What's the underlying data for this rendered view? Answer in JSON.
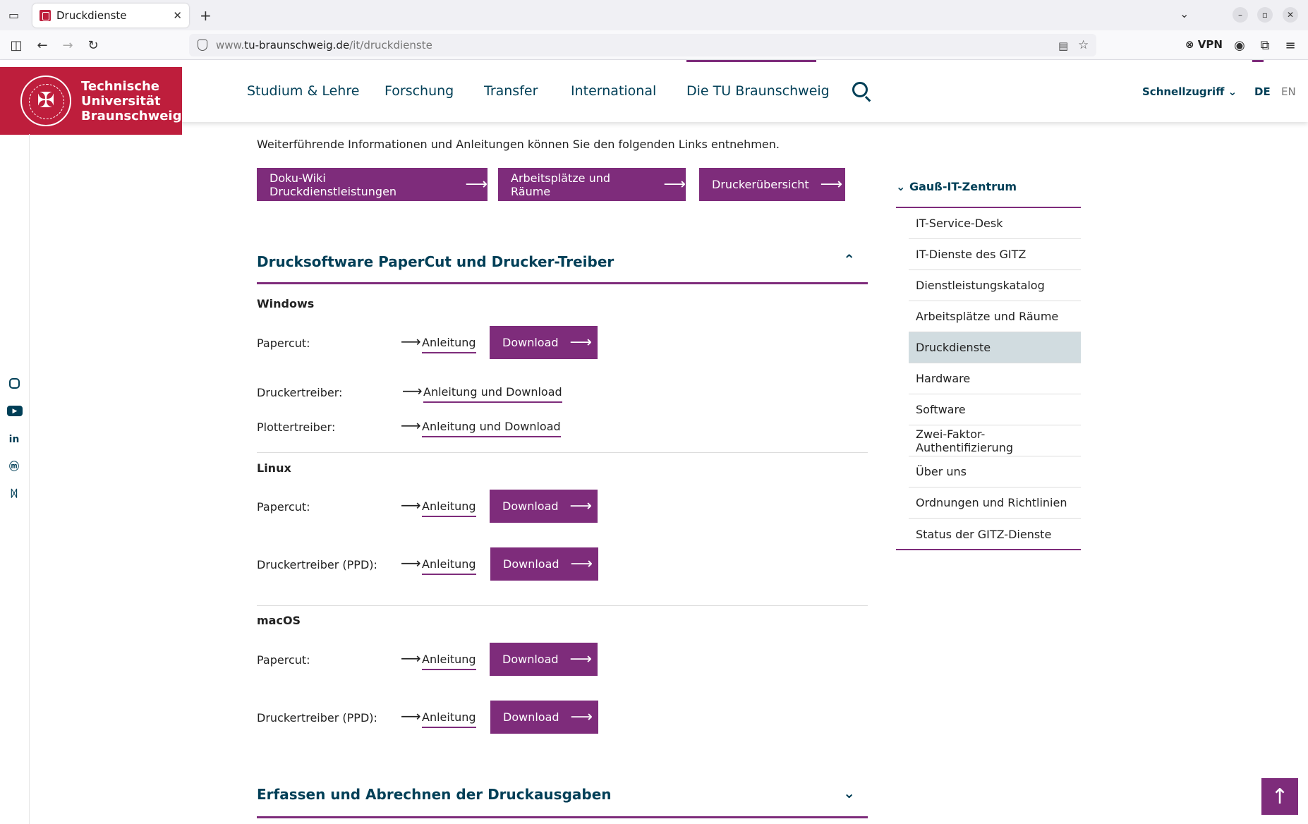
{
  "browser": {
    "tab_title": "Druckdienste",
    "url_prefix": "www.",
    "url_domain": "tu-braunschweig.de",
    "url_path": "/it/druckdienste",
    "vpn_label": "VPN"
  },
  "header": {
    "logo_lines": [
      "Technische",
      "Universität",
      "Braunschweig"
    ],
    "nav": [
      "Studium & Lehre",
      "Forschung",
      "Transfer",
      "International",
      "Die TU Braunschweig"
    ],
    "quick_access": "Schnellzugriff",
    "lang_de": "DE",
    "lang_en": "EN"
  },
  "content": {
    "intro": "Weiterführende Informationen und Anleitungen können Sie den folgenden Links entnehmen.",
    "top_buttons": [
      "Doku-Wiki Druckdienstleistungen",
      "Arbeitsplätze und Räume",
      "Druckerübersicht"
    ],
    "accordion1_title": "Drucksoftware PaperCut und Drucker-Treiber",
    "windows": {
      "label": "Windows",
      "papercut_label": "Papercut:",
      "papercut_link": "Anleitung",
      "papercut_download": "Download",
      "druckertreiber_label": "Druckertreiber:",
      "druckertreiber_link": "Anleitung und Download",
      "plottertreiber_label": "Plottertreiber:",
      "plottertreiber_link": "Anleitung und Download"
    },
    "linux": {
      "label": "Linux",
      "papercut_label": "Papercut:",
      "papercut_link": "Anleitung",
      "papercut_download": "Download",
      "ppd_label": "Druckertreiber (PPD):",
      "ppd_link": "Anleitung",
      "ppd_download": "Download"
    },
    "macos": {
      "label": "macOS",
      "papercut_label": "Papercut:",
      "papercut_link": "Anleitung",
      "papercut_download": "Download",
      "ppd_label": "Druckertreiber (PPD):",
      "ppd_link": "Anleitung",
      "ppd_download": "Download"
    },
    "accordion2_title": "Erfassen und Abrechnen der Druckausgaben"
  },
  "sidebar": {
    "heading": "Gauß-IT-Zentrum",
    "items": [
      "IT-Service-Desk",
      "IT-Dienste des GITZ",
      "Dienstleistungskatalog",
      "Arbeitsplätze und Räume",
      "Druckdienste",
      "Hardware",
      "Software",
      "Zwei-Faktor-Authentifizierung",
      "Über uns",
      "Ordnungen und Richtlinien",
      "Status der GITZ-Dienste"
    ],
    "active_index": 4
  },
  "social": [
    "instagram-icon",
    "youtube-icon",
    "linkedin-icon",
    "mastodon-icon",
    "bluesky-icon"
  ],
  "colors": {
    "brand_red": "#be1e3c",
    "accent_purple": "#7e2c7b",
    "nav_blue": "#003f57",
    "active_bg": "#d1dce0"
  }
}
